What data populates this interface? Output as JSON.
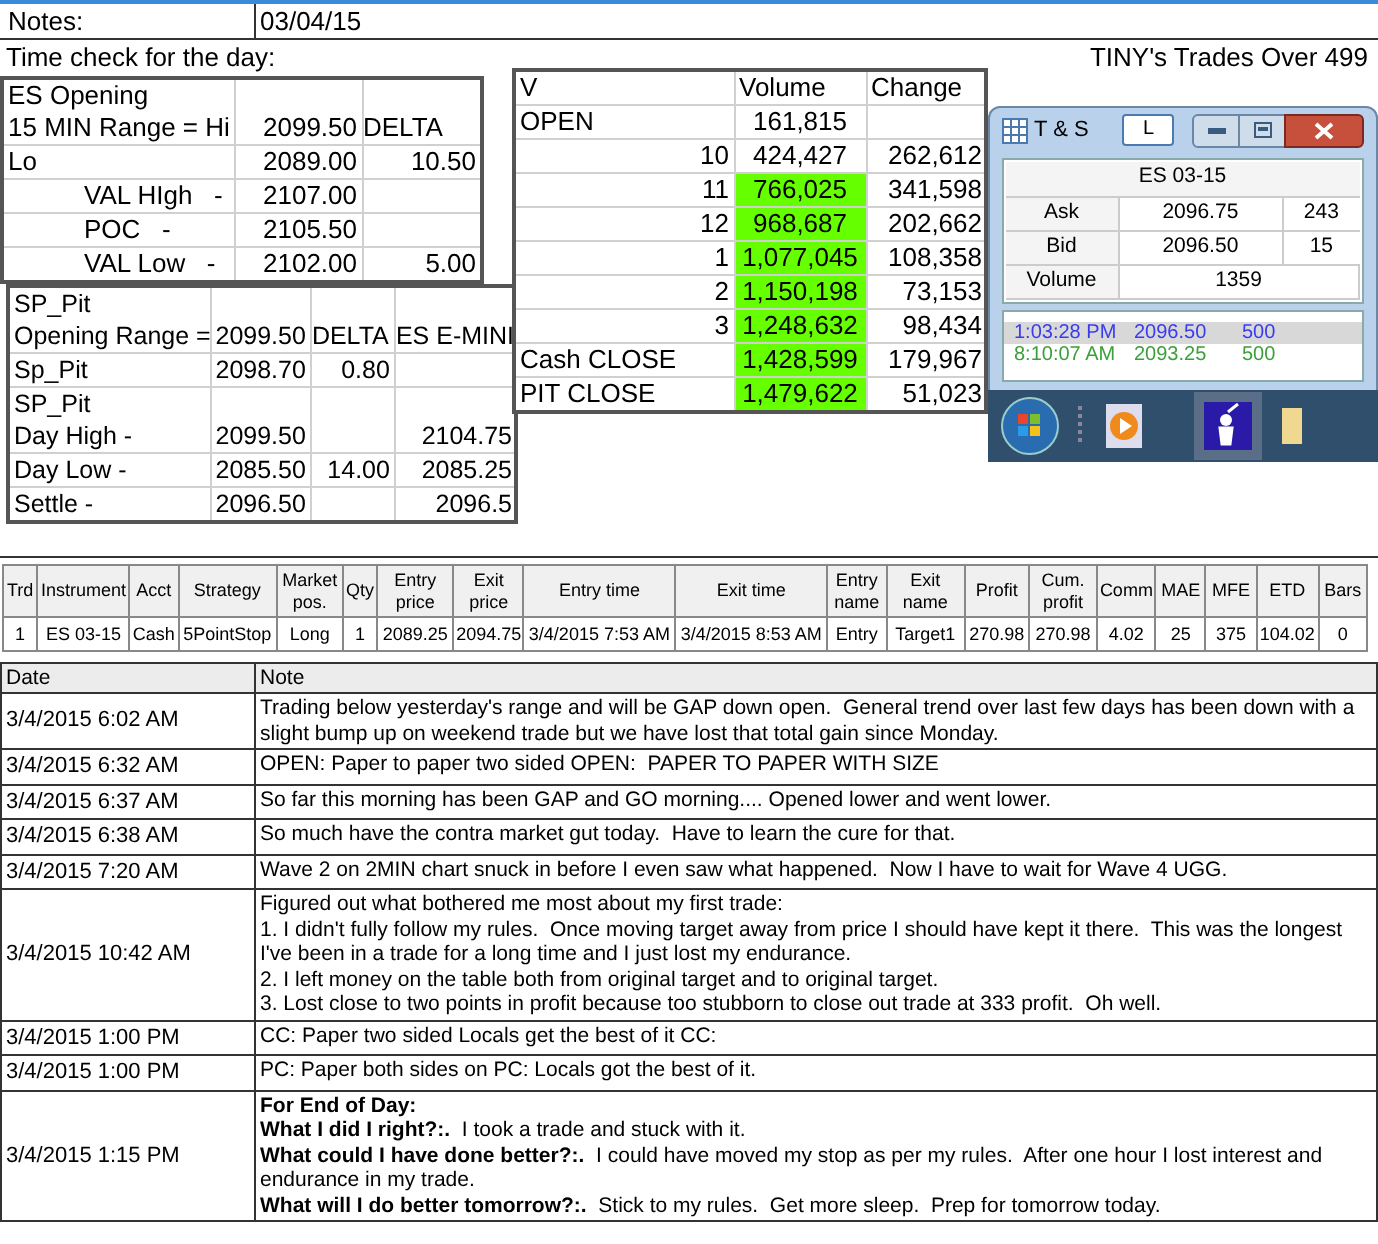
{
  "header": {
    "label": "Notes:",
    "value": "03/04/15"
  },
  "time_check": "Time check for the day:",
  "banner": "TINY's Trades Over 499",
  "es_opening": {
    "rows": [
      {
        "label": "ES Opening\n15 MIN Range = Hi",
        "value": "2099.50",
        "delta": "DELTA",
        "kind": "plain"
      },
      {
        "label": "Lo",
        "value": "2089.00",
        "delta": "10.50",
        "kind": "plain"
      },
      {
        "label": "VAL HIgh   -",
        "value": "2107.00",
        "kind": "indent"
      },
      {
        "label": "POC   -",
        "value": "2105.50",
        "kind": "indent"
      },
      {
        "label": "VAL Low   -",
        "value": "2102.00",
        "delta": "5.00",
        "kind": "indent"
      }
    ]
  },
  "sp_pit": {
    "rows": [
      {
        "label": "SP_Pit\nOpening Range =",
        "value": "2099.50",
        "delta": "DELTA",
        "es": "ES E-MINI"
      },
      {
        "label": "Sp_Pit",
        "value": "2098.70",
        "delta": "0.80"
      },
      {
        "label": "SP_Pit\nDay High -",
        "value": "2099.50",
        "es": "2104.75"
      },
      {
        "label": "Day Low -",
        "value": "2085.50",
        "delta": "14.00",
        "es": "2085.25"
      },
      {
        "label": "Settle -",
        "value": "2096.50",
        "es": "2096.5"
      }
    ]
  },
  "volume": {
    "columns": [
      "V",
      "Volume",
      "Change"
    ],
    "rows": [
      {
        "label": "OPEN",
        "kind": "text",
        "volume": "161,815",
        "highlighted": false
      },
      {
        "label": "10",
        "kind": "hour",
        "volume": "424,427",
        "change": "262,612",
        "highlighted": false
      },
      {
        "label": "11",
        "kind": "hour",
        "volume": "766,025",
        "change": "341,598",
        "highlighted": true
      },
      {
        "label": "12",
        "kind": "hour",
        "volume": "968,687",
        "change": "202,662",
        "highlighted": true
      },
      {
        "label": "1",
        "kind": "hour",
        "volume": "1,077,045",
        "change": "108,358",
        "highlighted": true
      },
      {
        "label": "2",
        "kind": "hour",
        "volume": "1,150,198",
        "change": "73,153",
        "highlighted": true
      },
      {
        "label": "3",
        "kind": "hour",
        "volume": "1,248,632",
        "change": "98,434",
        "highlighted": true
      },
      {
        "label": "Cash CLOSE",
        "kind": "text",
        "volume": "1,428,599",
        "change": "179,967",
        "highlighted": true
      },
      {
        "label": "PIT CLOSE",
        "kind": "text",
        "volume": "1,479,622",
        "change": "51,023",
        "highlighted": true
      }
    ]
  },
  "ts_window": {
    "title": "T & S",
    "link_button": "L",
    "symbol": "ES 03-15",
    "quote": [
      {
        "label": "Ask",
        "price": "2096.75",
        "size": "243"
      },
      {
        "label": "Bid",
        "price": "2096.50",
        "size": "15"
      },
      {
        "label": "Volume",
        "price": "1359"
      }
    ],
    "trades": [
      {
        "time": "1:03:28 PM",
        "price": "2096.50",
        "size": "500",
        "color": "#3a3af0",
        "selected": true
      },
      {
        "time": "8:10:07 AM",
        "price": "2093.25",
        "size": "500",
        "color": "#3aa03a",
        "selected": false
      }
    ]
  },
  "trades_table": {
    "columns": [
      "Trd",
      "Instrument",
      "Acct",
      "Strategy",
      "Market pos.",
      "Qty",
      "Entry price",
      "Exit price",
      "Entry time",
      "Exit time",
      "Entry name",
      "Exit name",
      "Profit",
      "Cum. profit",
      "Comm",
      "MAE",
      "MFE",
      "ETD",
      "Bars"
    ],
    "rows": [
      [
        "1",
        "ES 03-15",
        "Cash",
        "5PointStop",
        "Long",
        "1",
        "2089.25",
        "2094.75",
        "3/4/2015 7:53 AM",
        "3/4/2015 8:53 AM",
        "Entry",
        "Target1",
        "270.98",
        "270.98",
        "4.02",
        "25",
        "375",
        "104.02",
        "0"
      ]
    ]
  },
  "notes_table": {
    "columns": [
      "Date",
      "Note"
    ],
    "rows": [
      {
        "date": "3/4/2015 6:02 AM",
        "note": "Trading below yesterday's range and will be GAP down open.  General trend over last few days has been down with a slight bump up on weekend trade but we have lost that total gain since Monday."
      },
      {
        "date": "3/4/2015 6:32 AM",
        "note": "OPEN: Paper to paper two sided OPEN:  PAPER TO PAPER WITH SIZE"
      },
      {
        "date": "3/4/2015 6:37 AM",
        "note": "So far this morning has been GAP and GO morning.... Opened lower and went lower."
      },
      {
        "date": "3/4/2015 6:38 AM",
        "note": "So much have the contra market gut today.  Have to learn the cure for that."
      },
      {
        "date": "3/4/2015 7:20 AM",
        "note": "Wave 2 on 2MIN chart snuck in before I even saw what happened.  Now I have to wait for Wave 4 UGG."
      },
      {
        "date": "3/4/2015 10:42 AM",
        "note": "Figured out what bothered me most about my first trade:\n1. I didn't fully follow my rules.  Once moving target away from price I should have kept it there.  This was the longest I've been in a trade for a long time and I just lost my endurance.\n2. I left money on the table both from original target and to original target.\n3. Lost close to two points in profit because too stubborn to close out trade at 333 profit.  Oh well."
      },
      {
        "date": "3/4/2015 1:00 PM",
        "note": "CC: Paper two sided Locals get the best of it CC:"
      },
      {
        "date": "3/4/2015 1:00 PM",
        "note": "PC: Paper both sides on PC: Locals got the best of it."
      },
      {
        "date": "3/4/2015 1:15 PM",
        "note": "**For End of Day:**\n**What I did I right?:.**  I took a trade and stuck with it.\n**What could I have done better?:.**  I could have moved my stop as per my rules.  After one hour I lost interest and endurance in my trade.\n**What will I do better tomorrow?:.**  Stick to my rules.  Get more sleep.  Prep for tomorrow today."
      }
    ]
  }
}
